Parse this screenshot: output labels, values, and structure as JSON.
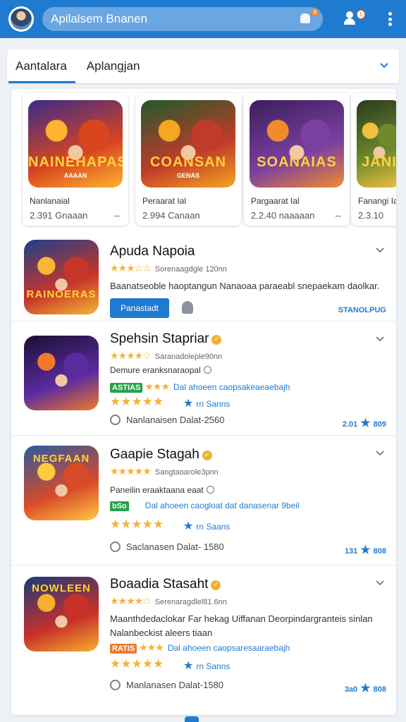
{
  "header": {
    "search_label": "Apilalsem Bnanen",
    "notif_badge": "8",
    "people_badge": "1"
  },
  "tabs": [
    {
      "label": "Aantalara"
    },
    {
      "label": "Aplangjan"
    }
  ],
  "carousel": [
    {
      "name": "Nanlanaial",
      "meta": "2.391 Gnaaan",
      "dash": "--",
      "art_title": "NAINEHAPAS",
      "art_sub": "AAAAN",
      "colors": [
        "#3a2a8a",
        "#d8451f",
        "#ffb32e"
      ]
    },
    {
      "name": "Peraarat Ial",
      "meta": "2.994 Canaan",
      "dash": "",
      "art_title": "COANSAN",
      "art_sub": "GENAS",
      "colors": [
        "#1f5a2a",
        "#c13b2a",
        "#f5a623"
      ]
    },
    {
      "name": "Pargaarat Ial",
      "meta": "2.2.40 naaaaan",
      "dash": "--",
      "art_title": "SOANAIAS",
      "art_sub": "",
      "colors": [
        "#3a1f5c",
        "#7a3fa0",
        "#f28a2e"
      ]
    },
    {
      "name": "Fanangi Ial",
      "meta": "2.3.10",
      "dash": "",
      "art_title": "JANI",
      "art_sub": "",
      "colors": [
        "#2b3a1f",
        "#6e8a2a",
        "#f0c040"
      ]
    }
  ],
  "apps": [
    {
      "title": "Apuda Napoia",
      "rating_text": "Sorenaagdgle 120nn",
      "desc": "Baanatseoble haoptangun Nanaoaa paraeabl snepaekam daolkar.",
      "install_label": "Panastadt",
      "status": "STANOLPUG",
      "art_title": "RAINOERAS",
      "colors": [
        "#1e3f8a",
        "#c6362a",
        "#f7b733"
      ]
    },
    {
      "title": "Spehsin Stapriar",
      "rating_text": "Saranadoleple90nn",
      "sub1": "Demure eranksnaraopal",
      "badge": "ASTIAS",
      "badge_text": "Dal ahoeen caopsakeaeaebajh",
      "star_link": "rn Sanns",
      "foot": "Nanlanaisen Dalat-2560",
      "count": "2.01",
      "count2": "809",
      "art_title": "",
      "colors": [
        "#1a1030",
        "#5a2aa0",
        "#f07a2a"
      ]
    },
    {
      "title": "Gaapie Stagah",
      "rating_text": "Sangtaoarole3pnn",
      "sub1": "Paneilin eraaktaana eaat",
      "badge": "bSo",
      "badge_text": "Dal ahoeen caogloat dat danasenar 9beil",
      "star_link": "rn Saans",
      "foot": "Saclanasen Dalat- 1580",
      "count": "131",
      "count2": "808",
      "art_title": "NEGFAAN",
      "colors": [
        "#2a5aa0",
        "#d84a2a",
        "#ffc940"
      ]
    },
    {
      "title": "Boaadia Stasaht",
      "rating_text": "Serenaragdlel81.6nn",
      "desc": "Maanthdedaclokar Far hekag Uiffanan Deorpindargranteis sinlan Nalanbeckist aleers tiaan",
      "badge": "RATIS",
      "badge_text": "Dal ahoeen caopsaresaaraebajh",
      "star_link": "rn Sanns",
      "foot": "Manlanasen Dalat-1580",
      "count": "3a0",
      "count2": "808",
      "art_title": "NOWLEEN",
      "colors": [
        "#1a3a7a",
        "#c8302a",
        "#f5b02e"
      ]
    }
  ],
  "colors": {
    "brand": "#1f7bd0",
    "star": "#f4b23a",
    "badge_green": "#23a34a",
    "badge_orange": "#f07a2a"
  }
}
